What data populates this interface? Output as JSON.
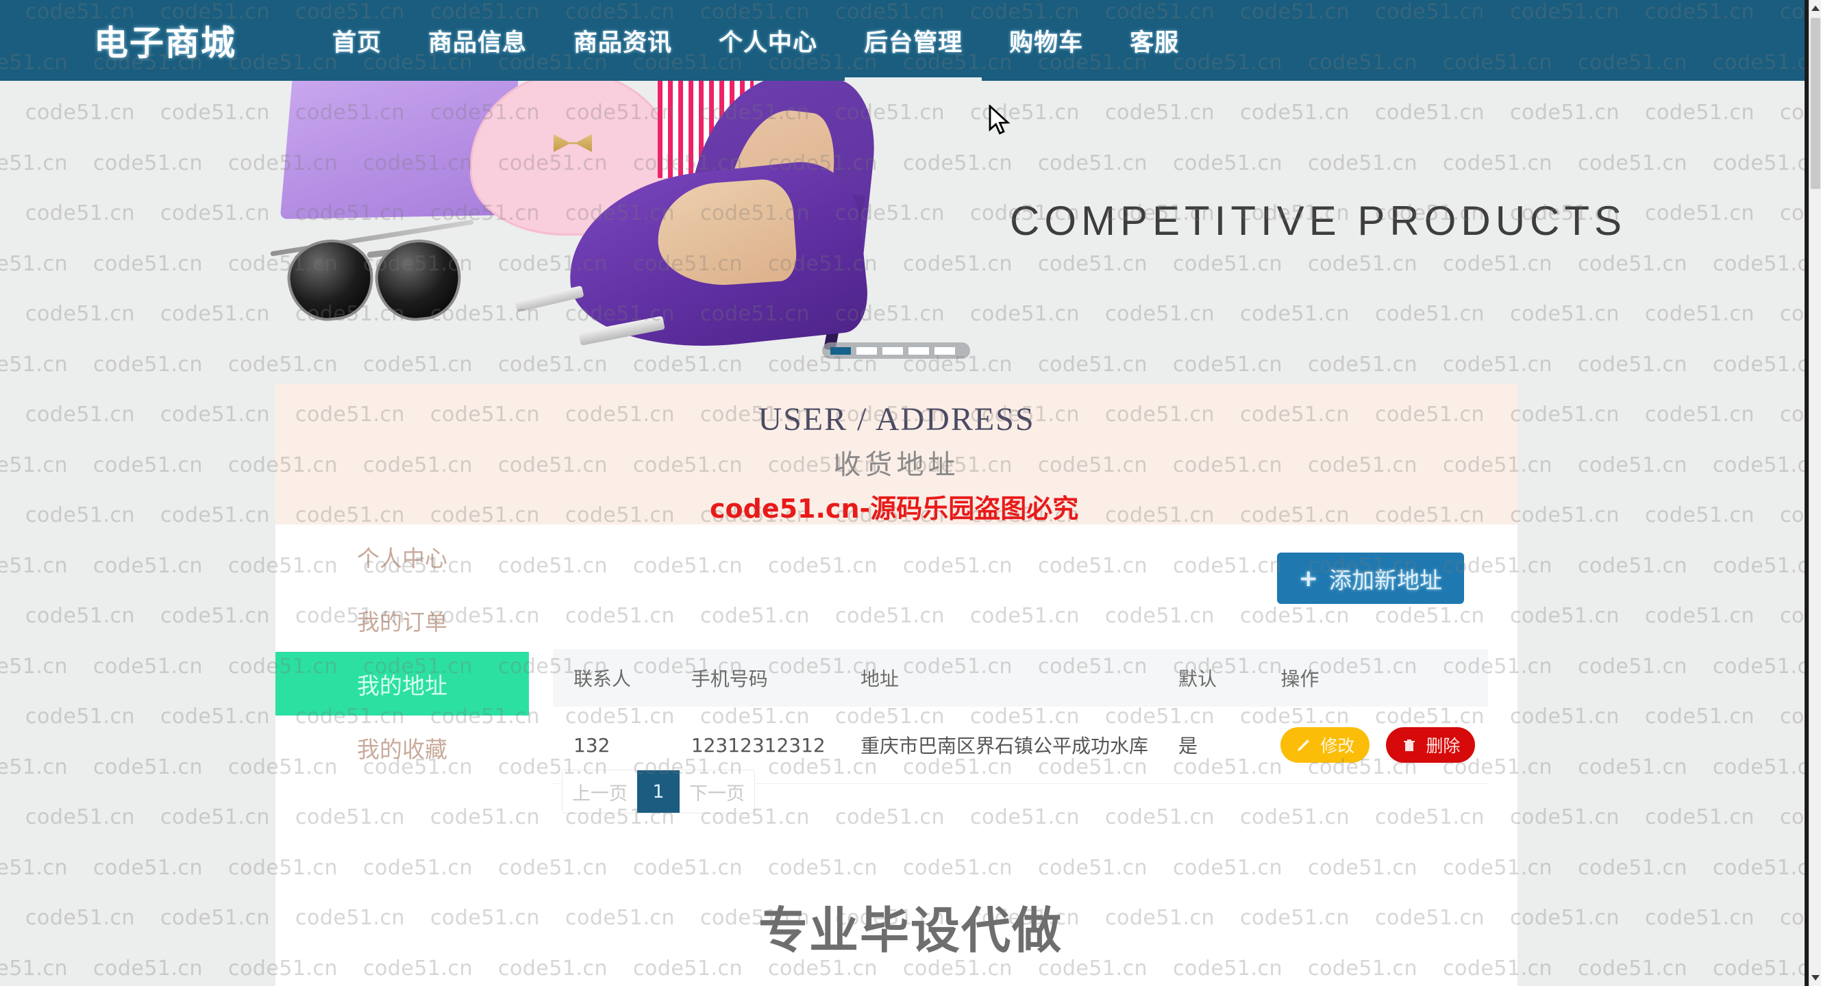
{
  "site": {
    "brand": "电子商城",
    "header_bg": "#1a5d7e",
    "nav": [
      {
        "label": "首页",
        "active": false
      },
      {
        "label": "商品信息",
        "active": false
      },
      {
        "label": "商品资讯",
        "active": false
      },
      {
        "label": "个人中心",
        "active": false
      },
      {
        "label": "后台管理",
        "active": true
      },
      {
        "label": "购物车",
        "active": false
      },
      {
        "label": "客服",
        "active": false
      }
    ]
  },
  "banner": {
    "headline": "COMPETITIVE  PRODUCTS",
    "slide_count": 5,
    "active_slide": 1,
    "dot_active_color": "#16628d"
  },
  "page_header": {
    "english": "USER / ADDRESS",
    "chinese": "收货地址"
  },
  "overlay": {
    "piracy_notice": "code51.cn-源码乐园盗图必究",
    "piracy_color": "#e81a1a",
    "watermark_text": "code51.cn",
    "promo": "专业毕设代做"
  },
  "sidebar": {
    "items": [
      {
        "label": "个人中心",
        "active": false
      },
      {
        "label": "我的订单",
        "active": false
      },
      {
        "label": "我的地址",
        "active": true
      },
      {
        "label": "我的收藏",
        "active": false
      }
    ],
    "active_color": "#2ce0a1"
  },
  "toolbar": {
    "add_label": "添加新地址",
    "add_icon": "plus-icon",
    "add_color": "#1f79b0"
  },
  "table": {
    "columns": [
      "联系人",
      "手机号码",
      "地址",
      "默认",
      "操作"
    ],
    "rows": [
      {
        "contact": "132",
        "phone": "12312312312",
        "address": "重庆市巴南区界石镇公平成功水库",
        "is_default": "是",
        "edit_label": "修改",
        "delete_label": "删除"
      }
    ]
  },
  "pagination": {
    "prev_label": "上一页",
    "next_label": "下一页",
    "current_page": "1"
  }
}
